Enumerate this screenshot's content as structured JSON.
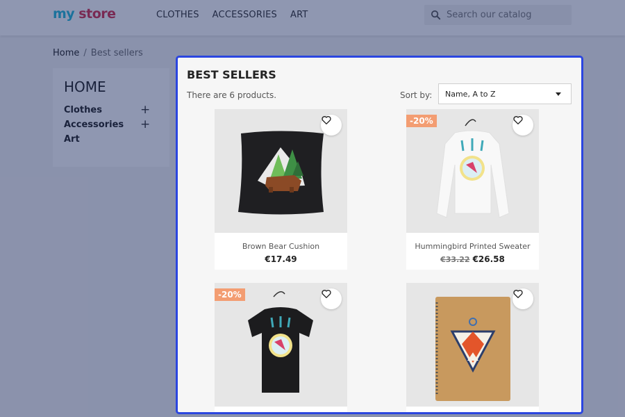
{
  "header": {
    "logo_my": "my",
    "logo_store": " store",
    "nav": [
      "CLOTHES",
      "ACCESSORIES",
      "ART"
    ],
    "search_placeholder": "Search our catalog"
  },
  "breadcrumb": {
    "home": "Home",
    "separator": "/",
    "current": "Best sellers"
  },
  "sidebar": {
    "title": "HOME",
    "items": [
      {
        "label": "Clothes",
        "expand": "+"
      },
      {
        "label": "Accessories",
        "expand": "+"
      },
      {
        "label": "Art"
      }
    ]
  },
  "listing": {
    "title": "BEST SELLERS",
    "count_text": "There are 6 products.",
    "sort_label": "Sort by:",
    "sort_value": "Name, A to Z",
    "products": [
      {
        "name": "Brown Bear Cushion",
        "price": "€17.49",
        "discount": "",
        "old_price": ""
      },
      {
        "name": "Hummingbird Printed Sweater",
        "price": "€26.58",
        "discount": "-20%",
        "old_price": "€33.22"
      },
      {
        "name": "",
        "price": "",
        "discount": "-20%",
        "old_price": ""
      },
      {
        "name": "",
        "price": "",
        "discount": "",
        "old_price": ""
      }
    ]
  },
  "colors": {
    "highlight": "#2b46e0",
    "discount": "#f39d72",
    "logo_blue": "#24b9d7",
    "logo_red": "#d6324f"
  }
}
